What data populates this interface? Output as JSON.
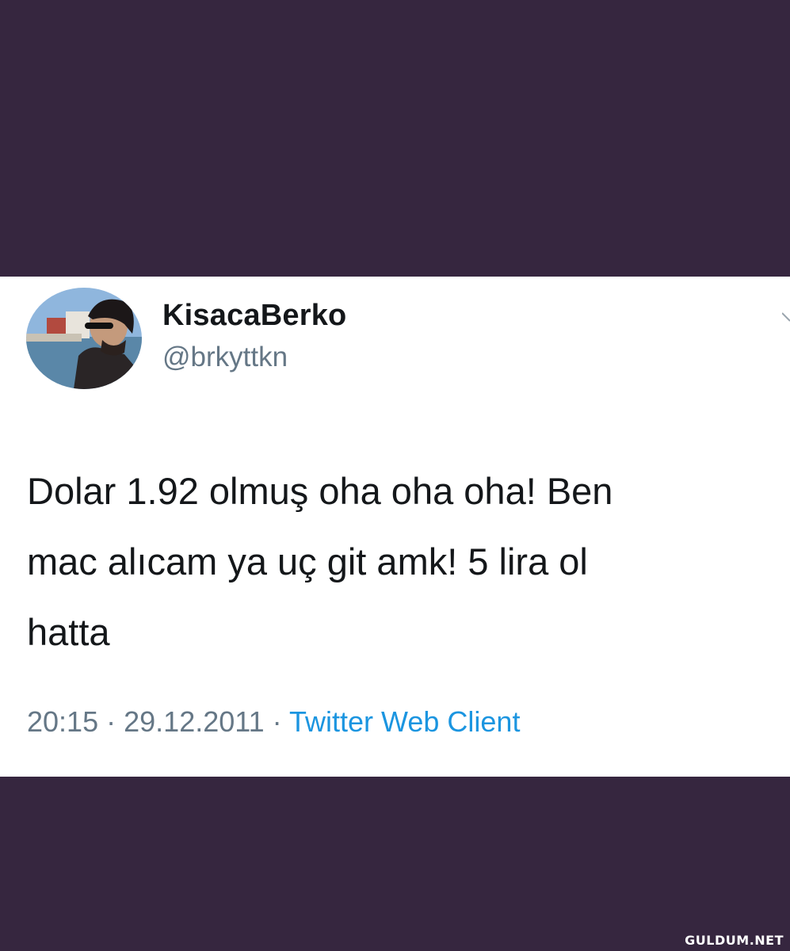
{
  "tweet": {
    "display_name": "KisacaBerko",
    "handle": "@brkyttkn",
    "text": "Dolar 1.92 olmuş oha oha oha! Ben\nmac alıcam ya uç git amk! 5 lira ol\nhatta",
    "time": "20:15",
    "date": "29.12.2011",
    "separator": "·",
    "source": "Twitter Web Client",
    "avatar_icon": "profile-photo",
    "menu_icon": "chevron-down-icon"
  },
  "watermark": {
    "text": "GULDUM.NET"
  },
  "colors": {
    "background": "#36263f",
    "card": "#ffffff",
    "text": "#14171a",
    "secondary": "#657786",
    "link": "#1b95e0"
  }
}
